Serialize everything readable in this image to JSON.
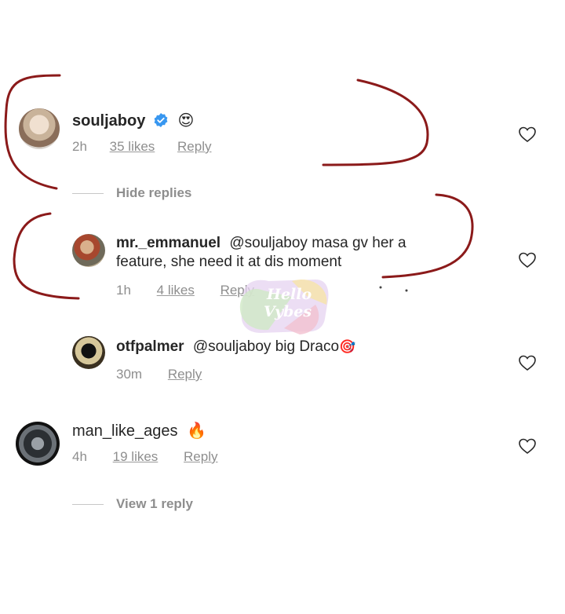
{
  "comments": [
    {
      "username": "souljaboy",
      "verified": true,
      "emoji": "😍",
      "time": "2h",
      "likes": "35 likes",
      "reply": "Reply",
      "replies_toggle": "Hide replies",
      "replies": [
        {
          "username": "mr._emmanuel",
          "text_line1": "@souljaboy masa gv her a",
          "text_line2": "feature, she need it at dis moment",
          "time": "1h",
          "likes": "4 likes",
          "reply": "Reply"
        },
        {
          "username": "otfpalmer",
          "text": "@souljaboy big Draco",
          "emoji": "🎯",
          "time": "30m",
          "reply": "Reply"
        }
      ]
    },
    {
      "username": "man_like_ages",
      "emoji": "🔥",
      "time": "4h",
      "likes": "19 likes",
      "reply": "Reply",
      "replies_toggle": "View 1 reply"
    }
  ],
  "watermark": {
    "line1": "Hello",
    "line2": "Vybes"
  },
  "icons": {
    "like": "heart-outline-icon",
    "verified": "verified-badge-icon"
  },
  "colors": {
    "annotation": "#8b1a1a",
    "verified": "#3897f0",
    "muted": "#8e8e8e",
    "text": "#262626"
  }
}
